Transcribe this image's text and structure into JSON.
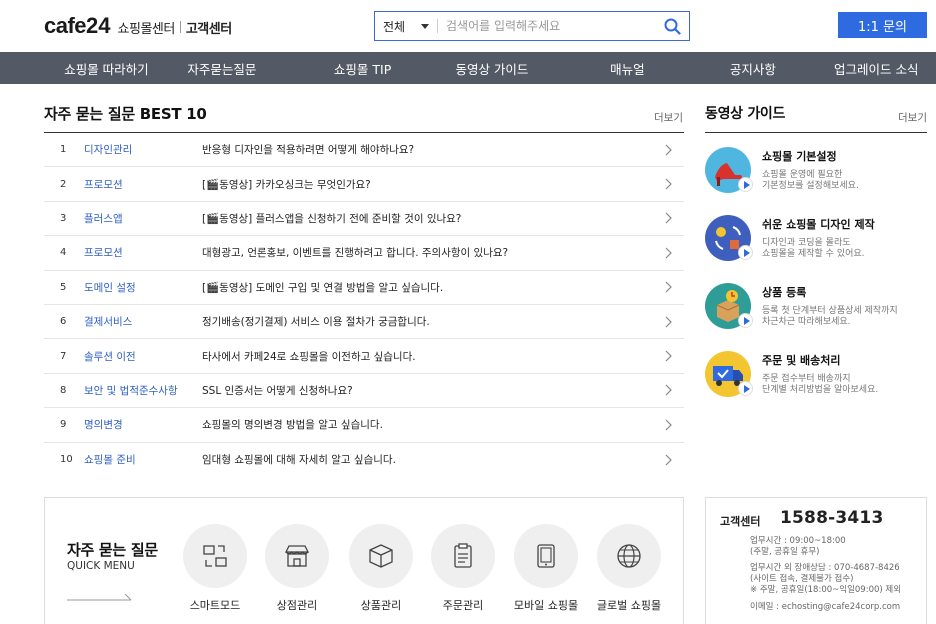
{
  "header": {
    "logo_word": "cafe",
    "logo_num": "24",
    "logo_sub": "쇼핑몰센터",
    "logo_sub2": "고객센터",
    "search_select": "전체",
    "search_placeholder": "검색어를 입력해주세요",
    "inquiry_label": "1:1 문의"
  },
  "nav": {
    "items": [
      "쇼핑몰 따라하기",
      "자주묻는질문",
      "쇼핑몰 TIP",
      "동영상 가이드",
      "매뉴얼",
      "공지사항",
      "업그레이드 소식"
    ]
  },
  "faq": {
    "title": "자주 묻는 질문 BEST 10",
    "more": "더보기",
    "rows": [
      {
        "num": "1",
        "cat": "디자인관리",
        "q": "반응형 디자인을 적용하려면 어떻게 해야하나요?"
      },
      {
        "num": "2",
        "cat": "프로모션",
        "q": "[🎬동영상] 카카오싱크는 무엇인가요?"
      },
      {
        "num": "3",
        "cat": "플러스앱",
        "q": "[🎬동영상] 플러스앱을 신청하기 전에 준비할 것이 있나요?"
      },
      {
        "num": "4",
        "cat": "프로모션",
        "q": "대형광고, 언론홍보, 이벤트를 진행하려고 합니다. 주의사항이 있나요?"
      },
      {
        "num": "5",
        "cat": "도메인 설정",
        "q": "[🎬동영상] 도메인 구입 및 연결 방법을 알고 싶습니다."
      },
      {
        "num": "6",
        "cat": "결제서비스",
        "q": "정기배송(정기결제) 서비스 이용 절차가 궁금합니다."
      },
      {
        "num": "7",
        "cat": "솔루션 이전",
        "q": "타사에서 카페24로 쇼핑몰을 이전하고 싶습니다."
      },
      {
        "num": "8",
        "cat": "보안 및 법적준수사항",
        "q": "SSL 인증서는 어떻게 신청하나요?"
      },
      {
        "num": "9",
        "cat": "명의변경",
        "q": "쇼핑몰의 명의변경 방법을 알고 싶습니다."
      },
      {
        "num": "10",
        "cat": "쇼핑몰 준비",
        "q": "임대형 쇼핑몰에 대해 자세히 알고 싶습니다."
      }
    ]
  },
  "video_guide": {
    "title": "동영상 가이드",
    "more": "더보기",
    "items": [
      {
        "name": "쇼핑몰 기본설정",
        "desc1": "쇼핑몰 운영에 필요한",
        "desc2": "기본정보를 설정해보세요.",
        "icon": "high-heel-icon",
        "color": "#4fb6e0"
      },
      {
        "name": "쉬운 쇼핑몰 디자인 제작",
        "desc1": "디자인과 코딩을 몰라도",
        "desc2": "쇼핑몰을 제작할 수 있어요.",
        "icon": "design-cycle-icon",
        "color": "#3f5fbf"
      },
      {
        "name": "상품 등록",
        "desc1": "등록 첫 단계부터 상품상세 제작까지",
        "desc2": "차근차근 따라해보세요.",
        "icon": "product-box-icon",
        "color": "#2e9d98"
      },
      {
        "name": "주문 및 배송처리",
        "desc1": "주문 접수부터 배송까지",
        "desc2": "단계별 처리방법을 알아보세요.",
        "icon": "delivery-truck-icon",
        "color": "#f2c531"
      }
    ]
  },
  "quick_menu": {
    "title": "자주 묻는 질문",
    "subtitle": "QUICK MENU",
    "items": [
      {
        "label": "스마트모드",
        "icon": "smart-mode-icon"
      },
      {
        "label": "상점관리",
        "icon": "store-icon"
      },
      {
        "label": "상품관리",
        "icon": "box-icon"
      },
      {
        "label": "주문관리",
        "icon": "clipboard-icon"
      },
      {
        "label": "모바일 쇼핑몰",
        "icon": "tablet-icon"
      },
      {
        "label": "글로벌 쇼핑몰",
        "icon": "globe-icon"
      }
    ]
  },
  "customer_center": {
    "label": "고객센터",
    "phone": "1588-3413",
    "lines": [
      "업무시간 : 09:00~18:00",
      "(주말, 공휴일 휴무)",
      "업무시간 외 장애상담 : 070-4687-8426",
      "(사이트 접속, 결제불가 접수)",
      "※ 주말, 공휴일(18:00~익일09:00) 제외",
      "이메일 : echosting@cafe24corp.com"
    ]
  },
  "colors": {
    "accent": "#2f6be0",
    "nav_bg": "#545a65",
    "link": "#2f5fc4"
  }
}
